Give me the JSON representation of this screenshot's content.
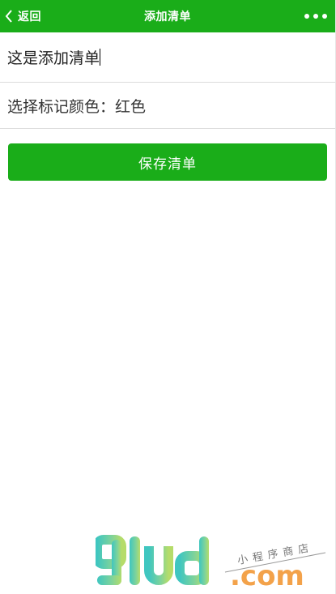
{
  "navbar": {
    "back_label": "返回",
    "title": "添加清单",
    "back_icon": "chevron-left-icon",
    "more_icon": "more-dots-icon"
  },
  "form": {
    "name_value": "这是添加清单",
    "color_picker_label": "选择标记颜色：红色"
  },
  "actions": {
    "save_label": "保存清单"
  },
  "watermark": {
    "brand": "9lud.com",
    "tagline": "小程序商店"
  },
  "colors": {
    "primary": "#1aad19",
    "background": "#ffffff",
    "divider": "#dcdcdc"
  }
}
